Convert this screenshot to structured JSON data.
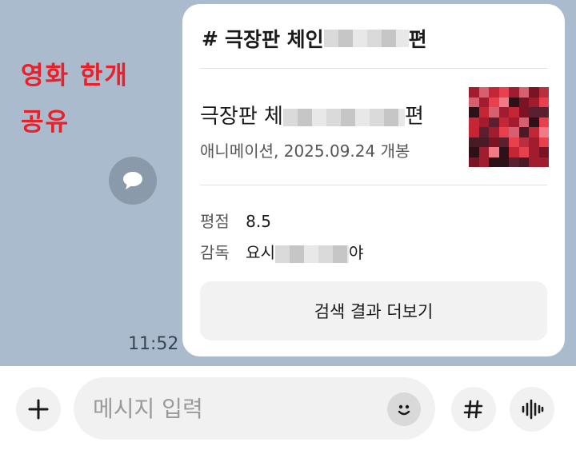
{
  "annotation": {
    "line1": "영화 한개",
    "line2": "공유"
  },
  "message": {
    "time": "11:52"
  },
  "card": {
    "header_hash": "#",
    "header_title_start": "극장판 체인",
    "header_title_end": "편",
    "title_start": "극장판 체",
    "title_end": "편",
    "meta": "애니메이션, 2025.09.24 개봉",
    "rating_label": "평점",
    "rating_value": "8.5",
    "director_label": "감독",
    "director_start": "요시",
    "director_end": "야",
    "more_button": "검색 결과 더보기"
  },
  "input_bar": {
    "placeholder": "메시지 입력",
    "add_icon": "plus-icon",
    "emoji_icon": "smiley-icon",
    "hashtag_icon": "hashtag-icon",
    "voice_icon": "voice-wave-icon"
  },
  "colors": {
    "chat_background": "#a9bbcd",
    "annotation": "#e8202a",
    "card_background": "#ffffff"
  }
}
